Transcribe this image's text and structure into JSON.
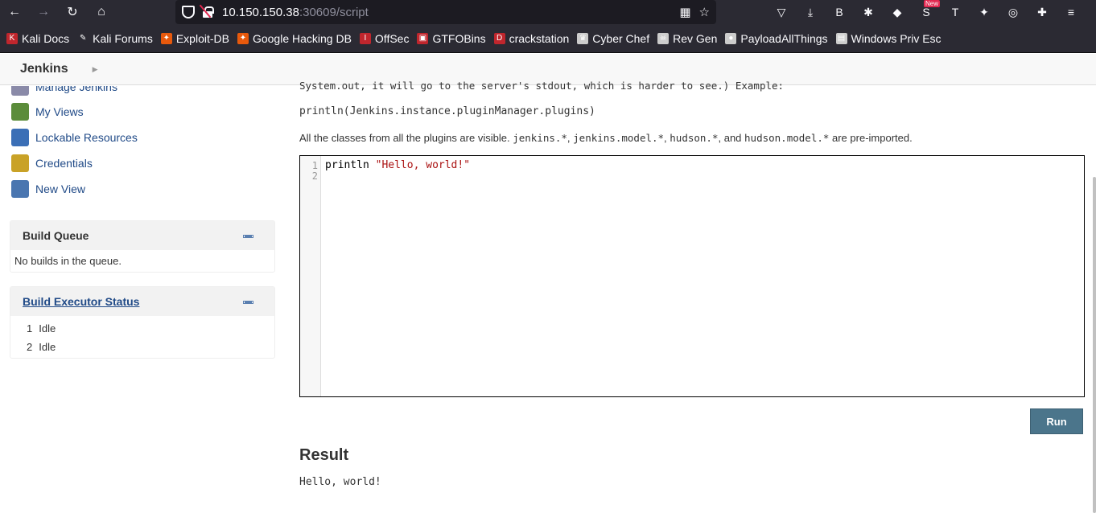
{
  "browser": {
    "url_host": "10.150.150.38",
    "url_rest": ":30609/script",
    "extensions": [
      {
        "name": "pocket-icon",
        "glyph": "▽"
      },
      {
        "name": "download-icon",
        "glyph": "⤓"
      },
      {
        "name": "b-extension-icon",
        "glyph": "B"
      },
      {
        "name": "puzzle-ext-icon",
        "glyph": "✱"
      },
      {
        "name": "cube-ext-icon",
        "glyph": "◆"
      },
      {
        "name": "news-ext-icon",
        "glyph": "S",
        "badge": "New"
      },
      {
        "name": "t-ext-icon",
        "glyph": "T"
      },
      {
        "name": "fox-ext-icon",
        "glyph": "✦"
      },
      {
        "name": "cookie-ext-icon",
        "glyph": "◎"
      },
      {
        "name": "extensions-icon",
        "glyph": "✚"
      },
      {
        "name": "menu-icon",
        "glyph": "≡"
      }
    ]
  },
  "bookmarks": [
    {
      "label": "Kali Docs",
      "color": "#c0262d",
      "glyph": "K"
    },
    {
      "label": "Kali Forums",
      "color": "#2b2a33",
      "glyph": "✎"
    },
    {
      "label": "Exploit-DB",
      "color": "#e8590c",
      "glyph": "✦"
    },
    {
      "label": "Google Hacking DB",
      "color": "#e8590c",
      "glyph": "✦"
    },
    {
      "label": "OffSec",
      "color": "#c0262d",
      "glyph": "I"
    },
    {
      "label": "GTFOBins",
      "color": "#c0262d",
      "glyph": "▣"
    },
    {
      "label": "crackstation",
      "color": "#c0262d",
      "glyph": "D"
    },
    {
      "label": "Cyber Chef",
      "color": "#cccccc",
      "glyph": "♛"
    },
    {
      "label": "Rev Gen",
      "color": "#cccccc",
      "glyph": "☠"
    },
    {
      "label": "PayloadAllThings",
      "color": "#cccccc",
      "glyph": "●"
    },
    {
      "label": "Windows Priv Esc",
      "color": "#cccccc",
      "glyph": "▤"
    }
  ],
  "jenkins": {
    "brand": "Jenkins",
    "sidebar": [
      {
        "label": "Manage Jenkins",
        "color": "#8a8aa8"
      },
      {
        "label": "My Views",
        "color": "#5b8c3a"
      },
      {
        "label": "Lockable Resources",
        "color": "#3b6fb6"
      },
      {
        "label": "Credentials",
        "color": "#c9a227"
      },
      {
        "label": "New View",
        "color": "#4a76b0"
      }
    ],
    "build_queue": {
      "title": "Build Queue",
      "empty_text": "No builds in the queue."
    },
    "executors": {
      "title": "Build Executor Status",
      "rows": [
        {
          "num": "1",
          "status": "Idle"
        },
        {
          "num": "2",
          "status": "Idle"
        }
      ]
    }
  },
  "main": {
    "intro_cut": "System.out, it will go to the server's stdout, which is harder to see.) Example:",
    "example_code": "println(Jenkins.instance.pluginManager.plugins)",
    "classes_pre": "All the classes from all the plugins are visible. ",
    "classes_c1": "jenkins.*",
    "classes_s1": ", ",
    "classes_c2": "jenkins.model.*",
    "classes_s2": ", ",
    "classes_c3": "hudson.*",
    "classes_s3": ", and ",
    "classes_c4": "hudson.model.*",
    "classes_post": " are pre-imported.",
    "editor": {
      "line1_num": "1",
      "line2_num": "2",
      "code_kw": "println ",
      "code_str": "\"Hello, world!\""
    },
    "run_label": "Run",
    "result_heading": "Result",
    "result_output": "Hello, world!"
  }
}
